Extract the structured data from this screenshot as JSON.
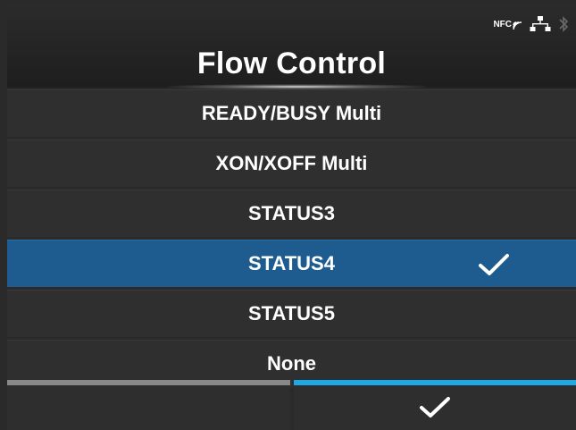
{
  "header": {
    "title": "Flow Control",
    "status": {
      "nfc_label": "NFC",
      "icons": [
        "nfc-icon",
        "network-icon",
        "bluetooth-icon"
      ]
    }
  },
  "options": [
    {
      "label": "READY/BUSY Multi",
      "selected": false
    },
    {
      "label": "XON/XOFF Multi",
      "selected": false
    },
    {
      "label": "STATUS3",
      "selected": false
    },
    {
      "label": "STATUS4",
      "selected": true
    },
    {
      "label": "STATUS5",
      "selected": false
    },
    {
      "label": "None",
      "selected": false
    }
  ],
  "footer": {
    "left_icon": "none",
    "right_icon": "checkmark-icon"
  },
  "colors": {
    "selected_row": "#1e5b8f",
    "accent_blue": "#1fa8e6",
    "footer_left_bar": "#888888"
  }
}
